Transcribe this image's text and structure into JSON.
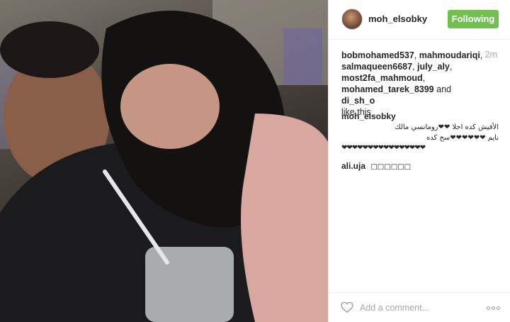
{
  "post": {
    "username": "moh_elsobky",
    "follow_label": "Following",
    "timestamp": "2m",
    "likers": [
      "bobmohamed537",
      "mahmoudariqi",
      "salmaqueen6687",
      "july_aly",
      "most2fa_mahmoud",
      "mohamed_tarek_8399",
      "di_sh_o"
    ],
    "likes_sep": ", ",
    "likes_and": " and ",
    "likes_suffix": "like this",
    "comments": [
      {
        "author": "moh_elsobky",
        "line1": "الأفيش كده احلا ❤❤رومانسي مالك",
        "line2": "نايم ❤❤❤❤❤❤سح كده",
        "line3": "❤❤❤❤❤❤❤❤❤❤❤❤❤❤❤❤"
      },
      {
        "author": "ali.uja",
        "text": "□□□□□□"
      }
    ],
    "comment_placeholder": "Add a comment...",
    "colors": {
      "follow_green": "#70c050",
      "muted": "#a5a7aa",
      "text": "#262626"
    },
    "icons": [
      "heart-outline-icon",
      "more-options-icon"
    ]
  }
}
